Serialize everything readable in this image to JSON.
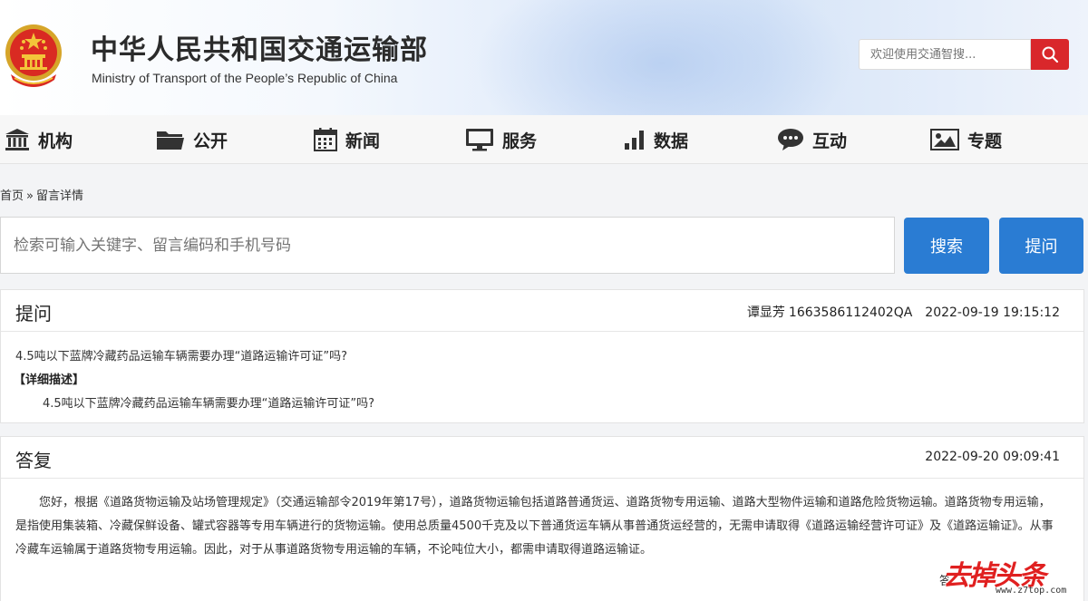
{
  "header": {
    "title": "中华人民共和国交通运输部",
    "subtitle": "Ministry of Transport of the People’s Republic of China",
    "search_placeholder": "欢迎使用交通智搜...",
    "search_icon": "search-icon",
    "accent": "#d9272b"
  },
  "nav": {
    "items": [
      {
        "label": "机构",
        "icon": "building-icon"
      },
      {
        "label": "公开",
        "icon": "folder-icon"
      },
      {
        "label": "新闻",
        "icon": "calendar-icon"
      },
      {
        "label": "服务",
        "icon": "monitor-icon"
      },
      {
        "label": "数据",
        "icon": "bar-chart-icon"
      },
      {
        "label": "互动",
        "icon": "chat-icon"
      },
      {
        "label": "专题",
        "icon": "image-icon"
      }
    ]
  },
  "breadcrumb": {
    "home": "首页",
    "separator": "»",
    "current": "留言详情"
  },
  "search": {
    "placeholder": "检索可输入关键字、留言编码和手机号码",
    "search_label": "搜索",
    "ask_label": "提问",
    "button_color": "#2a7cd3"
  },
  "question": {
    "heading": "提问",
    "author": "谭显芳",
    "code": "1663586112402QA",
    "datetime": "2022-09-19 19:15:12",
    "title": "4.5吨以下蓝牌冷藏药品运输车辆需要办理“道路运输许可证”吗?",
    "detail_label": "【详细描述】",
    "detail": "4.5吨以下蓝牌冷藏药品运输车辆需要办理“道路运输许可证”吗?"
  },
  "reply": {
    "heading": "答复",
    "datetime": "2022-09-20 09:09:41",
    "body": "您好，根据《道路货物运输及站场管理规定》（交通运输部令2019年第17号），道路货物运输包括道路普通货运、道路货物专用运输、道路大型物件运输和道路危险货物运输。道路货物专用运输，是指使用集装箱、冷藏保鲜设备、罐式容器等专用车辆进行的货物运输。使用总质量4500千克及以下普通货运车辆从事普通货运经营的，无需申请取得《道路运输经营许可证》及《道路运输证》。从事冷藏车运输属于道路货物专用运输。因此，对于从事道路货物专用运输的车辆，不论吨位大小，都需申请取得道路运输证。",
    "sign": "答"
  },
  "watermark": {
    "text": "去掉头条",
    "url": "www.z7top.com"
  }
}
